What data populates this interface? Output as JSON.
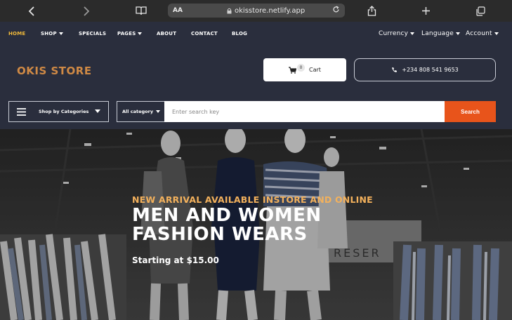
{
  "browser": {
    "text_size_label": "AA",
    "url": "okisstore.netlify.app"
  },
  "nav": {
    "items": [
      {
        "label": "HOME",
        "active": true
      },
      {
        "label": "SHOP",
        "dropdown": true
      },
      {
        "label": "SPECIALS"
      },
      {
        "label": "PAGES",
        "dropdown": true
      },
      {
        "label": "ABOUT"
      },
      {
        "label": "CONTACT"
      },
      {
        "label": "BLOG"
      }
    ],
    "right": [
      {
        "label": "Currency"
      },
      {
        "label": "Language"
      },
      {
        "label": "Account"
      }
    ]
  },
  "brand": {
    "logo": "OKIS STORE",
    "color": "#d08a45"
  },
  "cart": {
    "label": "Cart",
    "count": "0"
  },
  "phone": {
    "number": "+234 808 541 9653"
  },
  "categories": {
    "label": "Shop by Categories"
  },
  "search": {
    "category": "All category",
    "placeholder": "Enter search key",
    "value": "",
    "button": "Search",
    "button_color": "#e8541b"
  },
  "hero": {
    "subtitle": "NEW ARRIVAL AVAILABLE INSTORE AND ONLINE",
    "title_line1": "MEN AND WOMEN",
    "title_line2": "FASHION WEARS",
    "price": "Starting at $15.00",
    "subtitle_color": "#f3b15c"
  },
  "colors": {
    "background": "#2a2e3d",
    "active_nav": "#f0b93a"
  }
}
